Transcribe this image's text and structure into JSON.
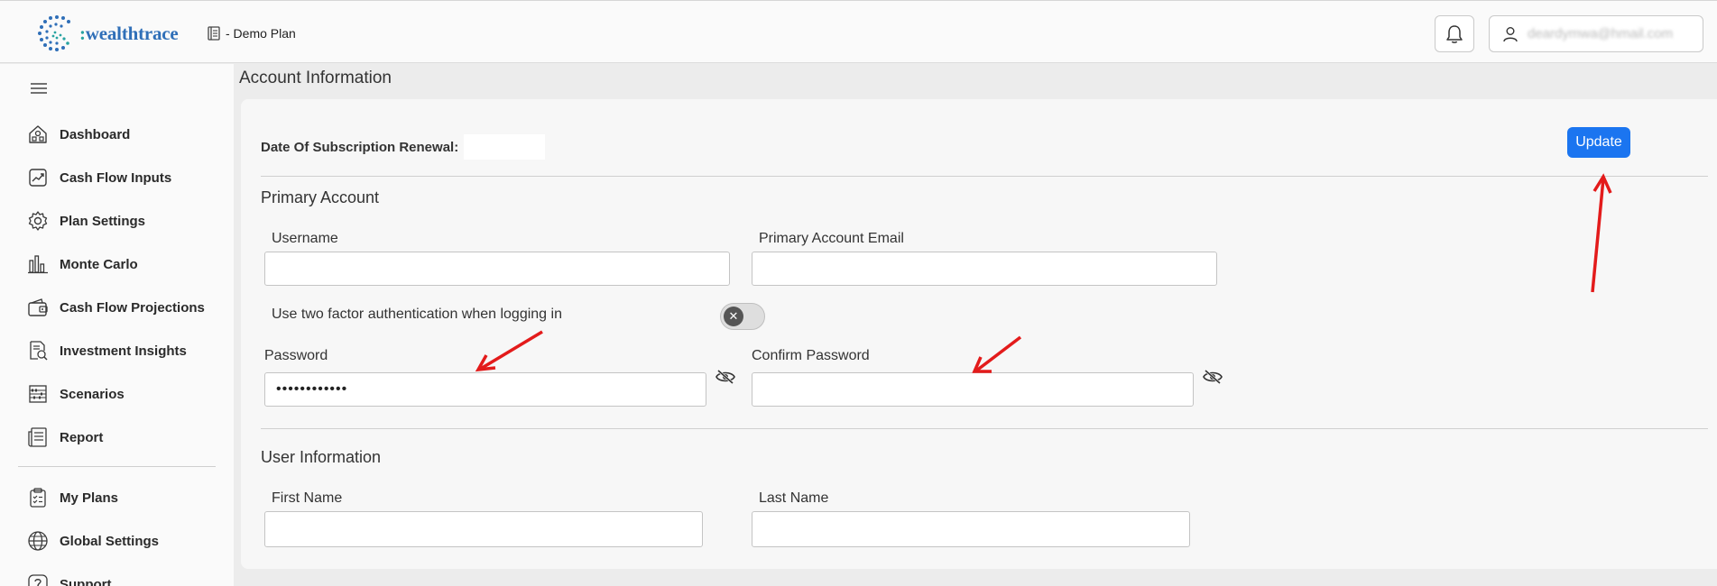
{
  "header": {
    "logo_prefix": ":",
    "logo_text": "wealthtrace",
    "plan_label": "- Demo Plan",
    "user_email": "deardymwa@hmail.com"
  },
  "sidebar": {
    "items": [
      {
        "label": "Dashboard",
        "icon": "house-icon"
      },
      {
        "label": "Cash Flow Inputs",
        "icon": "chart-up-icon"
      },
      {
        "label": "Plan Settings",
        "icon": "gear-icon"
      },
      {
        "label": "Monte Carlo",
        "icon": "bar-chart-icon"
      },
      {
        "label": "Cash Flow Projections",
        "icon": "wallet-icon"
      },
      {
        "label": "Investment Insights",
        "icon": "document-search-icon"
      },
      {
        "label": "Scenarios",
        "icon": "abacus-icon"
      },
      {
        "label": "Report",
        "icon": "report-icon"
      },
      {
        "label": "My Plans",
        "icon": "clipboard-icon"
      },
      {
        "label": "Global Settings",
        "icon": "globe-icon"
      },
      {
        "label": "Support",
        "icon": "question-icon"
      }
    ]
  },
  "main": {
    "title": "Account Information",
    "subscription_label": "Date Of Subscription Renewal:",
    "subscription_value": "",
    "update_label": "Update",
    "primary_section": "Primary Account",
    "username_label": "Username",
    "username_value": "",
    "email_label": "Primary Account Email",
    "email_value": "",
    "two_factor_label": "Use two factor authentication when logging in",
    "two_factor_enabled": false,
    "password_label": "Password",
    "password_value": "••••••••••••",
    "confirm_password_label": "Confirm Password",
    "confirm_password_value": "",
    "user_section": "User Information",
    "first_name_label": "First Name",
    "first_name_value": "",
    "last_name_label": "Last Name",
    "last_name_value": ""
  },
  "colors": {
    "accent": "#1b75f0",
    "annotation_arrow": "#e31b1b",
    "logo_blue": "#2f6fb8",
    "logo_teal": "#27a3a1"
  }
}
